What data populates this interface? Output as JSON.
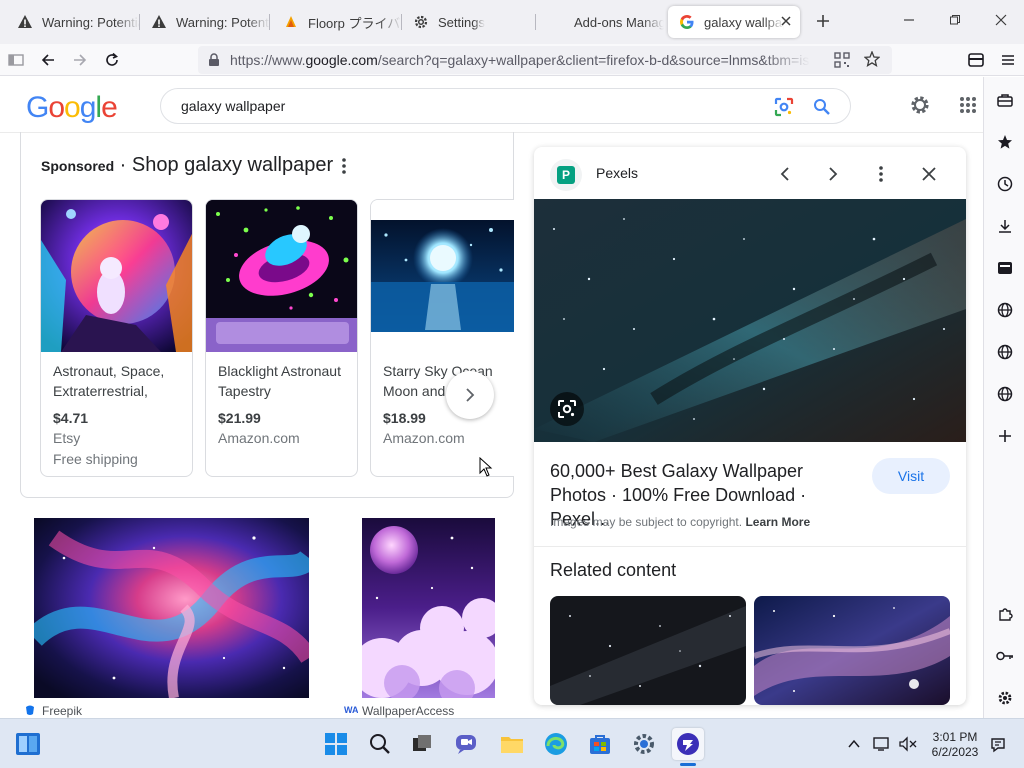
{
  "browser": {
    "tabs": [
      {
        "label": "Warning: Potential Security Risk Ahead",
        "icon": "warning-icon"
      },
      {
        "label": "Warning: Potential Security Risk Ahead",
        "icon": "warning-icon"
      },
      {
        "label": "Floorp プライバシー",
        "icon": "floorp-icon"
      },
      {
        "label": "Settings",
        "icon": "gear-icon"
      },
      {
        "label": "Add-ons Manager",
        "icon": "puzzle-icon"
      },
      {
        "label": "galaxy wallpaper",
        "icon": "google-icon"
      }
    ],
    "new_tab_symbol": "+",
    "url": {
      "scheme": "https://www.",
      "host": "google.com",
      "path": "/search?q=galaxy+wallpaper&client=firefox-b-d&source=lnms&tbm=isch"
    }
  },
  "google": {
    "logo": [
      "G",
      "o",
      "o",
      "g",
      "l",
      "e"
    ],
    "logo_colors": [
      "#4285f4",
      "#ea4335",
      "#fbbc05",
      "#4285f4",
      "#34a853",
      "#ea4335"
    ],
    "query": "galaxy wallpaper"
  },
  "sponsored": {
    "label": "Sponsored",
    "dot": " · ",
    "heading": "Shop galaxy wallpaper",
    "products": [
      {
        "title": "Astronaut, Space, Extraterrestrial,",
        "price": "$4.71",
        "store": "Etsy",
        "shipping": "Free shipping"
      },
      {
        "title": "Blacklight Astronaut Tapestry",
        "price": "$21.99",
        "store": "Amazon.com",
        "shipping": ""
      },
      {
        "title": "Starry Sky Ocean Moon and Stars",
        "price": "$18.99",
        "store": "Amazon.com",
        "shipping": ""
      }
    ]
  },
  "results": [
    {
      "source": "Freepik"
    },
    {
      "source": "WallpaperAccess"
    }
  ],
  "panel": {
    "source_name": "Pexels",
    "source_letter": "P",
    "title": "60,000+ Best Galaxy Wallpaper Photos · 100% Free Download · Pexel...",
    "visit": "Visit",
    "copyright": "Images may be subject to copyright.",
    "learn_more": "Learn More",
    "related": "Related content"
  },
  "taskbar": {
    "time": "3:01 PM",
    "date": "6/2/2023"
  },
  "colors": {
    "accent": "#1a73e8",
    "visit_bg": "#e8f0fe",
    "taskbar_bg": "#dfe7f3"
  }
}
